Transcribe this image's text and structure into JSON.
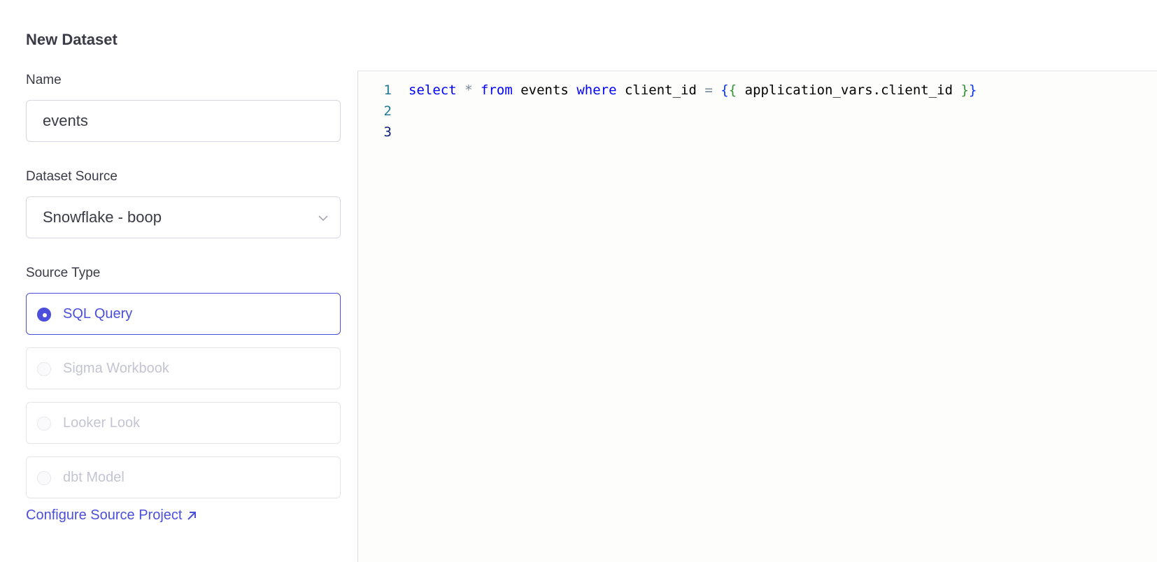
{
  "page": {
    "title": "New Dataset"
  },
  "name_field": {
    "label": "Name",
    "value": "events"
  },
  "source_field": {
    "label": "Dataset Source",
    "value": "Snowflake - boop"
  },
  "source_type": {
    "label": "Source Type",
    "options": [
      {
        "label": "SQL Query",
        "selected": true
      },
      {
        "label": "Sigma Workbook",
        "selected": false
      },
      {
        "label": "Looker Look",
        "selected": false
      },
      {
        "label": "dbt Model",
        "selected": false
      }
    ]
  },
  "configure_link": {
    "label": "Configure Source Project"
  },
  "editor": {
    "lines": [
      {
        "number": "1",
        "tokens": [
          "select",
          "*",
          "from",
          "events",
          "where",
          "client_id",
          "=",
          "{",
          "{",
          "application_vars.client_id",
          "}",
          "}"
        ]
      },
      {
        "number": "2"
      },
      {
        "number": "3"
      }
    ]
  },
  "colors": {
    "accent": "#4b4fdc",
    "keyword": "#0000ff",
    "line_number": "#237893"
  }
}
